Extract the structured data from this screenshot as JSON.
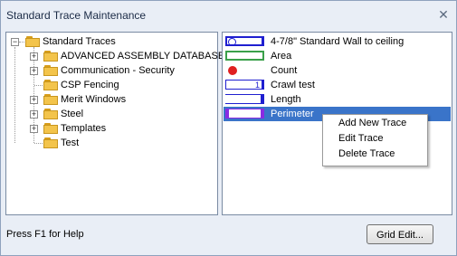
{
  "dialog": {
    "title": "Standard Trace Maintenance",
    "help_text": "Press F1 for Help",
    "grid_edit_label": "Grid Edit...",
    "close_glyph": "✕"
  },
  "tree": {
    "root": {
      "label": "Standard Traces",
      "expander": "−"
    },
    "children": [
      {
        "label": "ADVANCED ASSEMBLY DATABASE",
        "expander": "+"
      },
      {
        "label": "Communication - Security",
        "expander": "+"
      },
      {
        "label": "CSP Fencing",
        "expander": ""
      },
      {
        "label": "Merit Windows",
        "expander": "+"
      },
      {
        "label": "Steel",
        "expander": "+"
      },
      {
        "label": "Templates",
        "expander": "+"
      },
      {
        "label": "Test",
        "expander": ""
      }
    ]
  },
  "traces": [
    {
      "name": "4-7/8\" Standard Wall to ceiling",
      "swatch": "wall-icon",
      "color": "#1f1fd0"
    },
    {
      "name": "Area",
      "swatch": "area-icon",
      "color": "#3aa04a"
    },
    {
      "name": "Count",
      "swatch": "count-dot-icon",
      "color": "#e02020"
    },
    {
      "name": "Crawl test",
      "swatch": "crawl-icon",
      "color": "#1f1fd0",
      "badge": "1"
    },
    {
      "name": "Length",
      "swatch": "length-icon",
      "color": "#1f1fd0"
    },
    {
      "name": "Perimeter",
      "swatch": "perimeter-icon",
      "color": "#8a2be2",
      "selected": true
    }
  ],
  "context_menu": {
    "items": [
      "Add New Trace",
      "Edit Trace",
      "Delete Trace"
    ]
  },
  "colors": {
    "selection": "#3a74c9",
    "window_bg": "#e9eef6"
  }
}
